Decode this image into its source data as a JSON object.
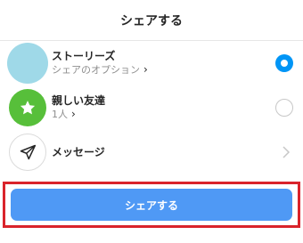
{
  "header": {
    "title": "シェアする"
  },
  "rows": [
    {
      "title": "ストーリーズ",
      "subtitle": "シェアのオプション",
      "subtitle_chevron": "›",
      "control": "radio",
      "selected": true,
      "avatar_color": "#9fd9e8"
    },
    {
      "title": "親しい友達",
      "subtitle": "1人",
      "subtitle_chevron": "›",
      "control": "radio",
      "selected": false,
      "avatar_color": "#57bf3a",
      "icon": "star-icon"
    },
    {
      "title": "メッセージ",
      "control": "chevron",
      "icon": "paper-plane-icon"
    }
  ],
  "share_button": {
    "label": "シェアする",
    "color": "#4f99f5"
  },
  "highlight_color": "#d9232b",
  "accent_color": "#0095f6"
}
